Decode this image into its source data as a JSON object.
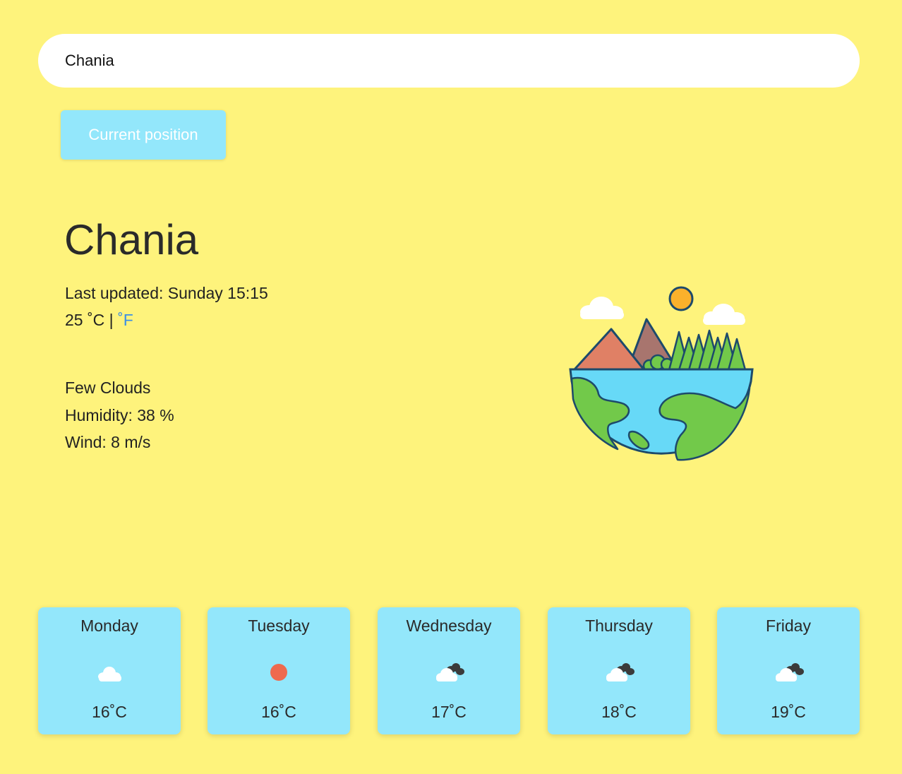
{
  "search": {
    "value": "Chania"
  },
  "current_position_button": {
    "label": "Current position"
  },
  "city": {
    "name": "Chania"
  },
  "current": {
    "last_updated": "Last updated: Sunday 15:15",
    "temperature": "25",
    "unit_celsius": "˚C",
    "separator": "|",
    "unit_fahrenheit": "˚F",
    "description": "Few Clouds",
    "humidity": "Humidity: 38 %",
    "wind": "Wind: 8 m/s"
  },
  "illustration": {
    "icon": "earth-landscape-illustration"
  },
  "colors": {
    "background": "#fef37c",
    "accent": "#93e7fb",
    "link": "#3a8ee6"
  },
  "forecast": [
    {
      "day": "Monday",
      "icon": "cloud-icon",
      "temp": "16˚C"
    },
    {
      "day": "Tuesday",
      "icon": "sun-icon",
      "temp": "16˚C"
    },
    {
      "day": "Wednesday",
      "icon": "broken-clouds-icon",
      "temp": "17˚C"
    },
    {
      "day": "Thursday",
      "icon": "broken-clouds-icon",
      "temp": "18˚C"
    },
    {
      "day": "Friday",
      "icon": "broken-clouds-icon",
      "temp": "19˚C"
    }
  ]
}
